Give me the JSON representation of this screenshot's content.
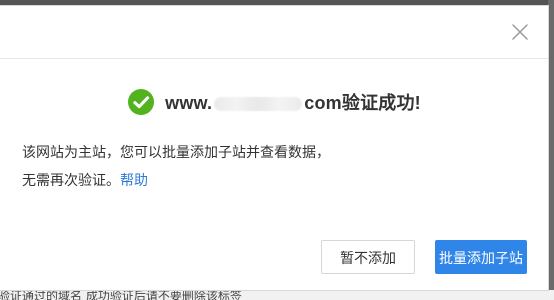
{
  "colors": {
    "accent": "#2f86e8",
    "success": "#52b31f",
    "overlay": "#5f5f5f",
    "text": "#333333",
    "link": "#2d7bd8"
  },
  "dialog": {
    "close_icon": "close-icon",
    "success": {
      "icon": "check-circle-icon",
      "prefix": "www.",
      "suffix": "com验证成功!"
    },
    "message": {
      "line1": "该网站为主站，您可以批量添加子站并查看数据，",
      "line2_prefix": "无需再次验证。",
      "help_link": "帮助"
    },
    "buttons": {
      "secondary": "暂不添加",
      "primary": "批量添加子站"
    }
  },
  "background": {
    "bottom_text": "验证通过的域名 成功验证后请不要删除该标签"
  }
}
